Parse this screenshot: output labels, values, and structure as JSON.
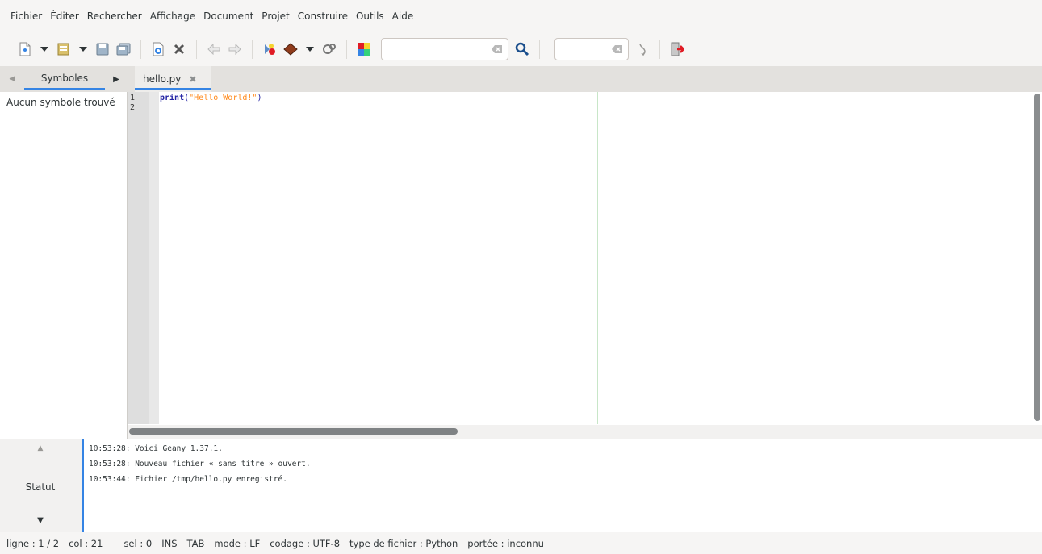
{
  "menu": [
    "Fichier",
    "Éditer",
    "Rechercher",
    "Affichage",
    "Document",
    "Projet",
    "Construire",
    "Outils",
    "Aide"
  ],
  "toolbar": {
    "icons": [
      "new-file-icon",
      "open-file-icon",
      "save-icon",
      "save-all-icon",
      "reload-icon",
      "close-icon",
      "navigate-back-icon",
      "navigate-forward-icon",
      "compile-icon",
      "build-icon",
      "execute-icon",
      "color-chooser-icon",
      "search-icon",
      "goto-line-icon",
      "quit-icon"
    ],
    "search_value": "",
    "goto_value": ""
  },
  "sidebar": {
    "tab_label": "Symboles",
    "message": "Aucun symbole trouvé"
  },
  "document_tab": {
    "label": "hello.py",
    "close": "✖"
  },
  "editor": {
    "line_numbers": [
      "1",
      "2"
    ],
    "code": {
      "keyword": "print",
      "open_paren": "(",
      "string": "\"Hello World!\"",
      "close_paren": ")"
    }
  },
  "message_panel": {
    "label": "Statut",
    "lines": [
      "10:53:28: Voici Geany 1.37.1.",
      "10:53:28: Nouveau fichier « sans titre » ouvert.",
      "10:53:44: Fichier /tmp/hello.py enregistré."
    ]
  },
  "statusbar": {
    "line": "ligne : 1 / 2",
    "col": "col : 21",
    "sel": "sel : 0",
    "ins": "INS",
    "tab": "TAB",
    "mode": "mode : LF",
    "encoding": "codage : UTF-8",
    "filetype": "type de fichier : Python",
    "scope": "portée : inconnu"
  },
  "colors": {
    "accent": "#3584e4",
    "keyword": "#2323a4",
    "string": "#ff8a1c"
  }
}
